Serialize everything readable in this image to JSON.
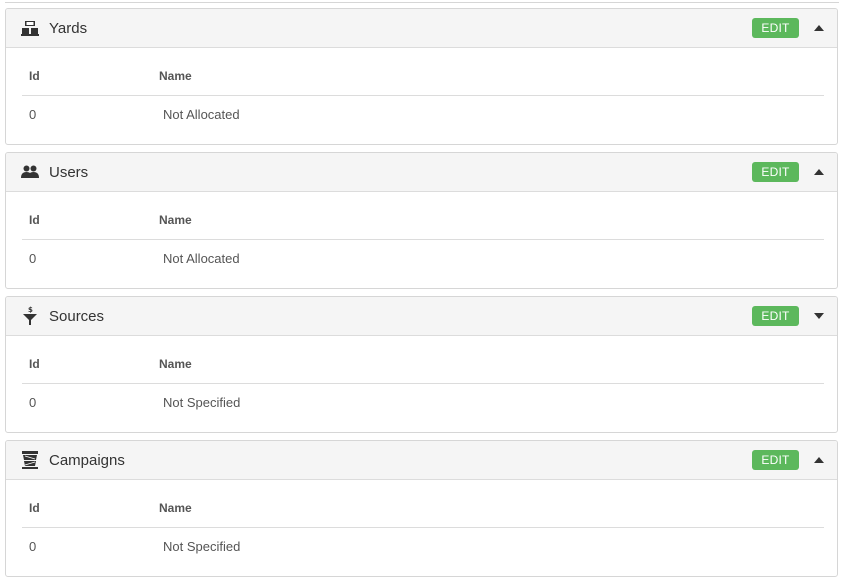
{
  "panels": [
    {
      "title": "Yards",
      "icon": "yards-icon",
      "edit_label": "EDIT",
      "caret": "up",
      "columns": {
        "id": "Id",
        "name": "Name"
      },
      "rows": [
        {
          "id": "0",
          "name": "Not Allocated"
        }
      ]
    },
    {
      "title": "Users",
      "icon": "users-icon",
      "edit_label": "EDIT",
      "caret": "up",
      "columns": {
        "id": "Id",
        "name": "Name"
      },
      "rows": [
        {
          "id": "0",
          "name": "Not Allocated"
        }
      ]
    },
    {
      "title": "Sources",
      "icon": "funnel-dollar-icon",
      "edit_label": "EDIT",
      "caret": "down",
      "columns": {
        "id": "Id",
        "name": "Name"
      },
      "rows": [
        {
          "id": "0",
          "name": "Not Specified"
        }
      ]
    },
    {
      "title": "Campaigns",
      "icon": "campaign-icon",
      "edit_label": "EDIT",
      "caret": "up",
      "columns": {
        "id": "Id",
        "name": "Name"
      },
      "rows": [
        {
          "id": "0",
          "name": "Not Specified"
        }
      ]
    }
  ],
  "colors": {
    "edit_button": "#5cb85c",
    "header_bg": "#f5f5f5",
    "border": "#d6d6d6"
  }
}
